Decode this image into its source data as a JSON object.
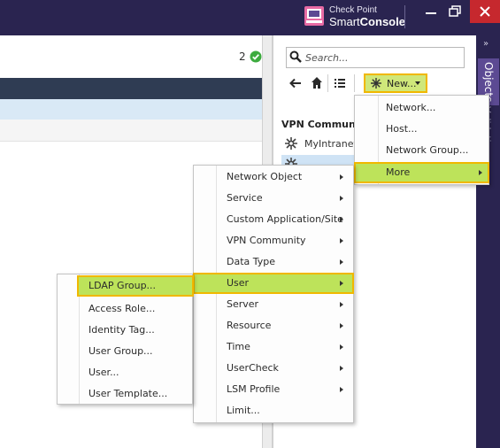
{
  "titlebar": {
    "brand_top": "Check Point",
    "brand_light": "Smart",
    "brand_bold": "Console",
    "colors": {
      "bg": "#2a2450",
      "close": "#c6282e"
    }
  },
  "main": {
    "count": "2"
  },
  "objects_pane": {
    "search_placeholder": "Search...",
    "new_button_label": "New...",
    "vpn_title": "VPN Communi",
    "vpn_items": [
      "MyIntranet",
      ""
    ]
  },
  "side_tabs": {
    "objects": "Objects",
    "validations": "Validations"
  },
  "new_menu": {
    "items": [
      "Network...",
      "Host...",
      "Network Group...",
      "More"
    ]
  },
  "more_menu": {
    "items": [
      "Network Object",
      "Service",
      "Custom Application/Site",
      "VPN Community",
      "Data Type",
      "User",
      "Server",
      "Resource",
      "Time",
      "UserCheck",
      "LSM Profile",
      "Limit..."
    ]
  },
  "user_menu": {
    "items": [
      "LDAP Group...",
      "Access Role...",
      "Identity Tag...",
      "User Group...",
      "User...",
      "User Template..."
    ]
  },
  "colors": {
    "highlight": "#bde35a",
    "focus_border": "#f0b800",
    "dark_band": "#2f3c53",
    "light_band": "#d9e9f6"
  }
}
